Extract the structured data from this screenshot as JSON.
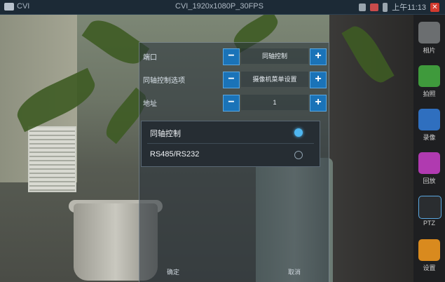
{
  "topbar": {
    "mode": "CVI",
    "resolution": "CVI_1920x1080P_30FPS",
    "clock": "上午11:13",
    "icons": [
      "camera-icon",
      "storage-icon",
      "network-icon",
      "battery-icon",
      "close-icon"
    ]
  },
  "settings": {
    "rows": [
      {
        "label": "端口",
        "value": "同轴控制"
      },
      {
        "label": "同轴控制选项",
        "value": "摄像机菜单设置"
      },
      {
        "label": "地址",
        "value": "1"
      }
    ]
  },
  "dropdown": {
    "options": [
      {
        "label": "同轴控制",
        "selected": true
      },
      {
        "label": "RS485/RS232",
        "selected": false
      }
    ]
  },
  "footer": {
    "confirm_label": "确定",
    "cancel_label": "取消"
  },
  "sidebar": {
    "items": [
      {
        "label": "相片",
        "icon": "photo-icon",
        "color": "#6b6e70"
      },
      {
        "label": "拍照",
        "icon": "camera-snapshot-icon",
        "color": "#3f9a3c"
      },
      {
        "label": "录像",
        "icon": "video-record-icon",
        "color": "#2f6fbf"
      },
      {
        "label": "回放",
        "icon": "playback-icon",
        "color": "#b03ab0"
      },
      {
        "label": "PTZ",
        "icon": "ptz-icon",
        "color": "#2a2d30"
      },
      {
        "label": "设置",
        "icon": "settings-tools-icon",
        "color": "#d98a1e"
      }
    ]
  },
  "colors": {
    "accent": "#1a73b8",
    "selected_radio": "#4fb6f0",
    "topbar": "#1c2a36",
    "sidebar": "#1e1f21"
  }
}
